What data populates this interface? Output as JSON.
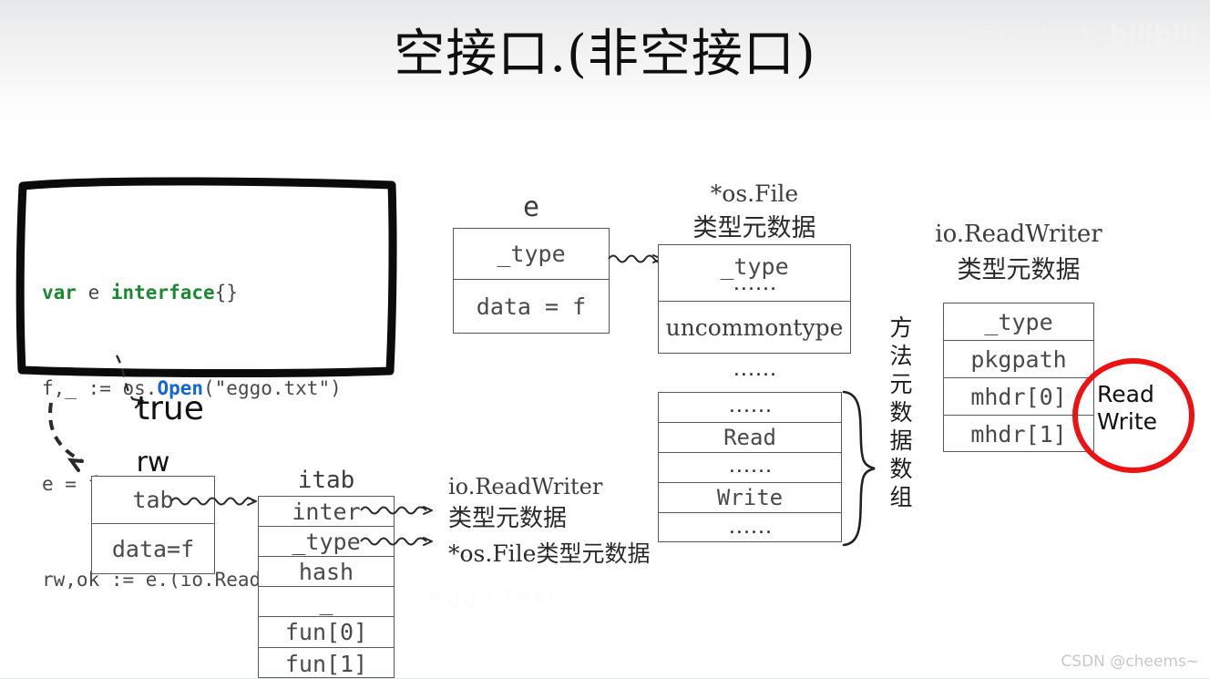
{
  "title": "空接口.(非空接口)",
  "code": {
    "line1_kw": "var",
    "line1_rest": " e ",
    "line1_kw2": "interface",
    "line1_tail": "{}",
    "line2_pre": "f,_ := os.",
    "line2_fn": "Open",
    "line2_tail": "(\"eggo.txt\")",
    "line3": "e = f",
    "line4": "rw,ok := e.(io.ReadWriter)"
  },
  "annotations": {
    "true_label": "true",
    "rw_label": "rw",
    "itab_label": "itab",
    "e_label": "e"
  },
  "e_box": {
    "rows": [
      "_type",
      "data = f"
    ]
  },
  "osfile_meta": {
    "caption_en": "*os.File",
    "caption_cn": "类型元数据",
    "row_type": "_type",
    "row_type_dots": "......",
    "row_uncommon": "uncommontype",
    "dots_below": "......"
  },
  "method_table": {
    "rows": [
      "......",
      "Read",
      "......",
      "Write",
      "......"
    ],
    "brace_label_chars": [
      "方",
      "法",
      "元",
      "数",
      "据",
      "数",
      "组"
    ]
  },
  "readwriter_meta": {
    "caption_en": "io.ReadWriter",
    "caption_cn": "类型元数据",
    "rows": [
      "_type",
      "pkgpath",
      "mhdr[0]",
      "mhdr[1]"
    ]
  },
  "red_circle": {
    "line1": "Read",
    "line2": "Write",
    "color": "#ee1111"
  },
  "rw_box": {
    "rows": [
      "tab",
      "data=f"
    ]
  },
  "itab_box": {
    "rows": [
      "inter",
      "_type",
      "hash",
      "_",
      "fun[0]",
      "fun[1]"
    ]
  },
  "itab_targets": {
    "inter_en": "io.ReadWriter",
    "inter_cn": "类型元数据",
    "type_label": "*os.File类型元数据"
  },
  "watermarks": {
    "top_text": "eggo-tech",
    "top_logo": "bilibili",
    "bottom": "CSDN @cheems~",
    "middle": "eggo-tech"
  },
  "colors": {
    "keyword_green": "#1a8a32",
    "func_blue": "#1266d6",
    "ink": "#111111",
    "box_stroke": "#5a5a5a",
    "red": "#ee1111"
  }
}
